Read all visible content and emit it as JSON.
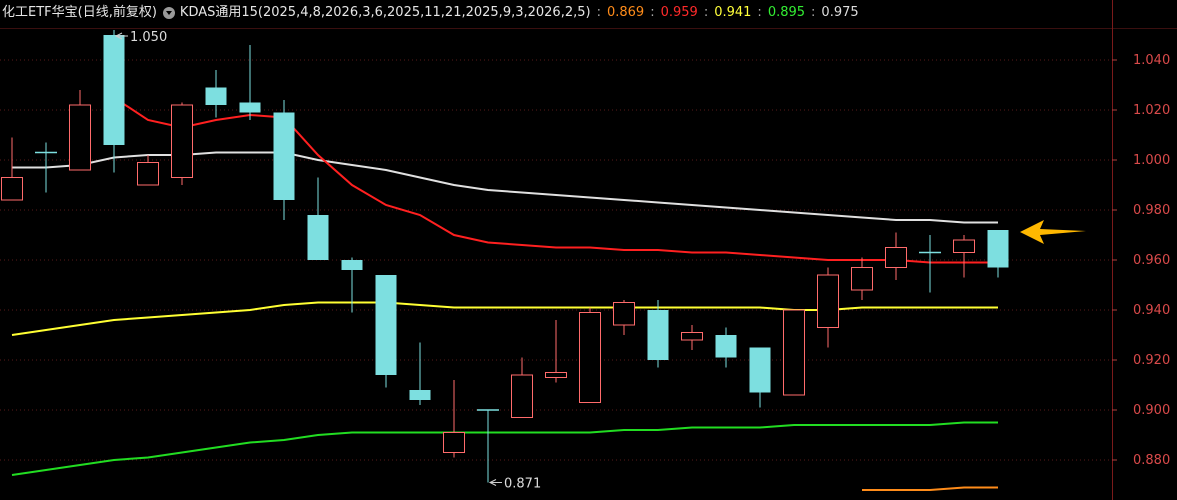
{
  "header": {
    "title": "化工ETF华宝(日线,前复权)",
    "indicator": "KDAS通用15(2025,4,8,2026,3,6,2025,11,21,2025,9,3,2026,2,5)",
    "values": [
      {
        "text": "0.869",
        "color": "#ff8c1a"
      },
      {
        "text": "0.959",
        "color": "#ff2a2a"
      },
      {
        "text": "0.941",
        "color": "#ffff3a"
      },
      {
        "text": "0.895",
        "color": "#33ee33"
      },
      {
        "text": "0.975",
        "color": "#dddddd"
      }
    ],
    "separator": ":"
  },
  "chart_data": {
    "type": "candlestick",
    "ylim": [
      0.872,
      1.052
    ],
    "y_ticks": [
      "1.040",
      "1.020",
      "1.000",
      "0.980",
      "0.960",
      "0.940",
      "0.920",
      "0.900",
      "0.880"
    ],
    "up_color": "#ff6b6b",
    "down_color": "#7ddfe0",
    "grid": true,
    "candles": [
      {
        "o": 0.984,
        "h": 1.009,
        "l": 0.984,
        "c": 0.993
      },
      {
        "o": 1.003,
        "h": 1.007,
        "l": 0.987,
        "c": 1.003
      },
      {
        "o": 0.996,
        "h": 1.028,
        "l": 0.996,
        "c": 1.022
      },
      {
        "o": 1.05,
        "h": 1.052,
        "l": 0.995,
        "c": 1.006
      },
      {
        "o": 0.99,
        "h": 1.002,
        "l": 0.99,
        "c": 0.999
      },
      {
        "o": 0.993,
        "h": 1.023,
        "l": 0.99,
        "c": 1.022
      },
      {
        "o": 1.029,
        "h": 1.036,
        "l": 1.017,
        "c": 1.022
      },
      {
        "o": 1.023,
        "h": 1.046,
        "l": 1.016,
        "c": 1.019
      },
      {
        "o": 1.019,
        "h": 1.024,
        "l": 0.976,
        "c": 0.984
      },
      {
        "o": 0.978,
        "h": 0.993,
        "l": 0.96,
        "c": 0.96
      },
      {
        "o": 0.96,
        "h": 0.961,
        "l": 0.939,
        "c": 0.956
      },
      {
        "o": 0.954,
        "h": 0.954,
        "l": 0.909,
        "c": 0.914
      },
      {
        "o": 0.908,
        "h": 0.927,
        "l": 0.902,
        "c": 0.904
      },
      {
        "o": 0.883,
        "h": 0.912,
        "l": 0.881,
        "c": 0.891
      },
      {
        "o": 0.9,
        "h": 0.9,
        "l": 0.871,
        "c": 0.9
      },
      {
        "o": 0.897,
        "h": 0.921,
        "l": 0.897,
        "c": 0.914
      },
      {
        "o": 0.913,
        "h": 0.936,
        "l": 0.911,
        "c": 0.915
      },
      {
        "o": 0.903,
        "h": 0.941,
        "l": 0.903,
        "c": 0.939
      },
      {
        "o": 0.934,
        "h": 0.944,
        "l": 0.93,
        "c": 0.943
      },
      {
        "o": 0.94,
        "h": 0.944,
        "l": 0.917,
        "c": 0.92
      },
      {
        "o": 0.928,
        "h": 0.934,
        "l": 0.924,
        "c": 0.931
      },
      {
        "o": 0.93,
        "h": 0.933,
        "l": 0.917,
        "c": 0.921
      },
      {
        "o": 0.925,
        "h": 0.925,
        "l": 0.901,
        "c": 0.907
      },
      {
        "o": 0.906,
        "h": 0.94,
        "l": 0.906,
        "c": 0.94
      },
      {
        "o": 0.933,
        "h": 0.957,
        "l": 0.925,
        "c": 0.954
      },
      {
        "o": 0.948,
        "h": 0.961,
        "l": 0.944,
        "c": 0.957
      },
      {
        "o": 0.957,
        "h": 0.971,
        "l": 0.952,
        "c": 0.965
      },
      {
        "o": 0.963,
        "h": 0.97,
        "l": 0.947,
        "c": 0.963
      },
      {
        "o": 0.963,
        "h": 0.97,
        "l": 0.953,
        "c": 0.968
      },
      {
        "o": 0.972,
        "h": 0.972,
        "l": 0.953,
        "c": 0.957
      }
    ],
    "series": [
      {
        "color": "#e0e0e0",
        "values": [
          0.997,
          0.997,
          0.998,
          1.001,
          1.002,
          1.002,
          1.003,
          1.003,
          1.003,
          1.0,
          0.998,
          0.996,
          0.993,
          0.99,
          0.988,
          0.987,
          0.986,
          0.985,
          0.984,
          0.983,
          0.982,
          0.981,
          0.98,
          0.979,
          0.978,
          0.977,
          0.976,
          0.976,
          0.975,
          0.975
        ]
      },
      {
        "color": "#ff2020",
        "values": [
          null,
          null,
          null,
          1.025,
          1.016,
          1.013,
          1.016,
          1.018,
          1.017,
          1.002,
          0.99,
          0.982,
          0.978,
          0.97,
          0.967,
          0.966,
          0.965,
          0.965,
          0.964,
          0.964,
          0.963,
          0.963,
          0.962,
          0.961,
          0.96,
          0.96,
          0.96,
          0.959,
          0.959,
          0.959
        ]
      },
      {
        "color": "#ffff33",
        "values": [
          0.93,
          0.932,
          0.934,
          0.936,
          0.937,
          0.938,
          0.939,
          0.94,
          0.942,
          0.943,
          0.943,
          0.943,
          0.942,
          0.941,
          0.941,
          0.941,
          0.941,
          0.941,
          0.941,
          0.941,
          0.941,
          0.941,
          0.941,
          0.94,
          0.94,
          0.941,
          0.941,
          0.941,
          0.941,
          0.941
        ]
      },
      {
        "color": "#22dd22",
        "values": [
          0.874,
          0.876,
          0.878,
          0.88,
          0.881,
          0.883,
          0.885,
          0.887,
          0.888,
          0.89,
          0.891,
          0.891,
          0.891,
          0.891,
          0.891,
          0.891,
          0.891,
          0.891,
          0.892,
          0.892,
          0.893,
          0.893,
          0.893,
          0.894,
          0.894,
          0.894,
          0.894,
          0.894,
          0.895,
          0.895
        ]
      },
      {
        "color": "#ff8c1a",
        "values": [
          null,
          null,
          null,
          null,
          null,
          null,
          null,
          null,
          null,
          null,
          null,
          null,
          null,
          null,
          null,
          null,
          null,
          null,
          null,
          null,
          null,
          null,
          null,
          null,
          null,
          0.868,
          0.868,
          0.868,
          0.869,
          0.869
        ]
      }
    ],
    "annotations": [
      {
        "text": "1.050",
        "candle": 3,
        "at": "high"
      },
      {
        "text": "0.871",
        "candle": 14,
        "at": "low"
      }
    ],
    "marker": {
      "kind": "arrow-left",
      "color": "#ffb800"
    }
  }
}
